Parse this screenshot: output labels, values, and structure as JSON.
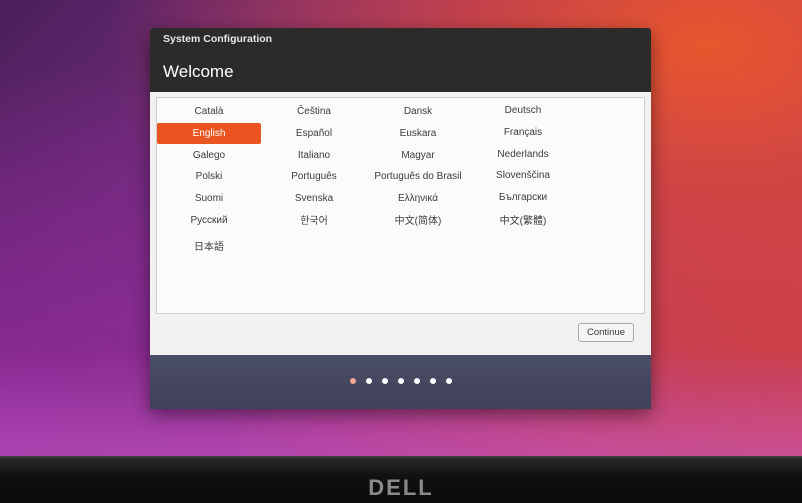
{
  "window": {
    "title": "System Configuration",
    "heading": "Welcome"
  },
  "languages": {
    "selected": "English",
    "items": [
      "Català",
      "Čeština",
      "Dansk",
      "Deutsch",
      "English",
      "Español",
      "Euskara",
      "Français",
      "Galego",
      "Italiano",
      "Magyar",
      "Nederlands",
      "Polski",
      "Português",
      "Português do Brasil",
      "Slovenščina",
      "Suomi",
      "Svenska",
      "Ελληνικά",
      "Български",
      "Русский",
      "한국어",
      "中文(简体)",
      "中文(繁體)",
      "日本語"
    ]
  },
  "buttons": {
    "continue": "Continue"
  },
  "progress": {
    "total_steps": 7,
    "current_step": 1
  },
  "brand": "DELL",
  "colors": {
    "accent": "#e95420",
    "titlebar": "#2c2b2a",
    "footer": "#454862"
  }
}
